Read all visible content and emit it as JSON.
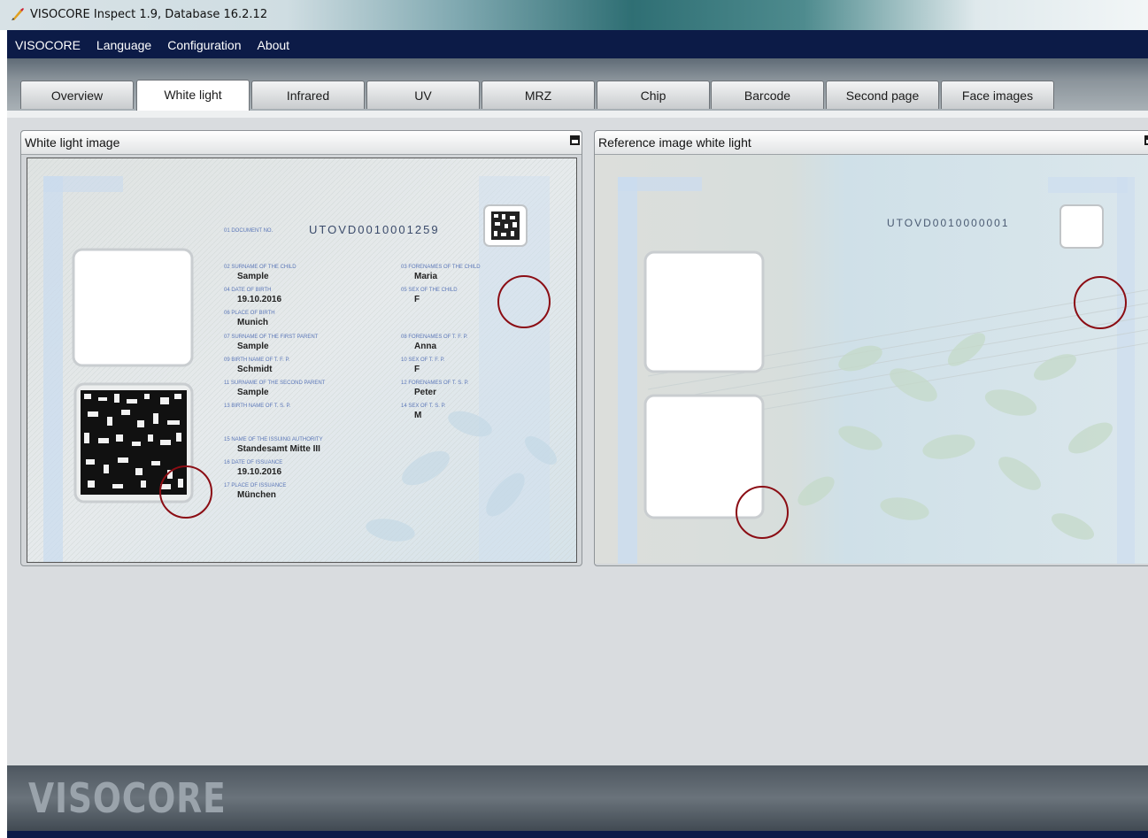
{
  "window": {
    "title": "VISOCORE Inspect 1.9, Database 16.2.12"
  },
  "menu": [
    "VISOCORE",
    "Language",
    "Configuration",
    "About"
  ],
  "tabs": [
    "Overview",
    "White light",
    "Infrared",
    "UV",
    "MRZ",
    "Chip",
    "Barcode",
    "Second page",
    "Face images"
  ],
  "active_tab": "White light",
  "panels": {
    "left": {
      "title": "White light image",
      "document": {
        "doc_no_label": "01 DOCUMENT NO.",
        "doc_no": "UTOVD0010001259",
        "fields": [
          {
            "label": "02 SURNAME OF THE CHILD",
            "value": "Sample"
          },
          {
            "label": "04 DATE OF BIRTH",
            "value": "19.10.2016"
          },
          {
            "label": "06 PLACE OF BIRTH",
            "value": "Munich"
          },
          {
            "label": "07 SURNAME OF THE FIRST PARENT",
            "value": "Sample"
          },
          {
            "label": "09 BIRTH NAME OF T. F. P.",
            "value": "Schmidt"
          },
          {
            "label": "11 SURNAME OF THE SECOND PARENT",
            "value": "Sample"
          },
          {
            "label": "13 BIRTH NAME OF T. S. P.",
            "value": ""
          },
          {
            "label": "03 FORENAMES OF THE CHILD",
            "value": "Maria"
          },
          {
            "label": "05 SEX OF THE CHILD",
            "value": "F"
          },
          {
            "label": "08 FORENAMES OF T. F. P.",
            "value": "Anna"
          },
          {
            "label": "10 SEX OF T. F. P.",
            "value": "F"
          },
          {
            "label": "12 FORENAMES OF T. S. P.",
            "value": "Peter"
          },
          {
            "label": "14 SEX OF T. S. P.",
            "value": "M"
          },
          {
            "label": "15 NAME OF THE ISSUING AUTHORITY",
            "value": "Standesamt Mitte III"
          },
          {
            "label": "16 DATE OF ISSUANCE",
            "value": "19.10.2016"
          },
          {
            "label": "17 PLACE OF ISSUANCE",
            "value": "München"
          }
        ]
      }
    },
    "right": {
      "title": "Reference image white light",
      "document": {
        "doc_no": "UTOVD0010000001"
      }
    }
  },
  "footer": {
    "brand": "VISOCORE"
  },
  "colors": {
    "menubar": "#0c1b47",
    "highlight_circle": "#8b0d14",
    "doc_blue": "#5b77b8"
  }
}
